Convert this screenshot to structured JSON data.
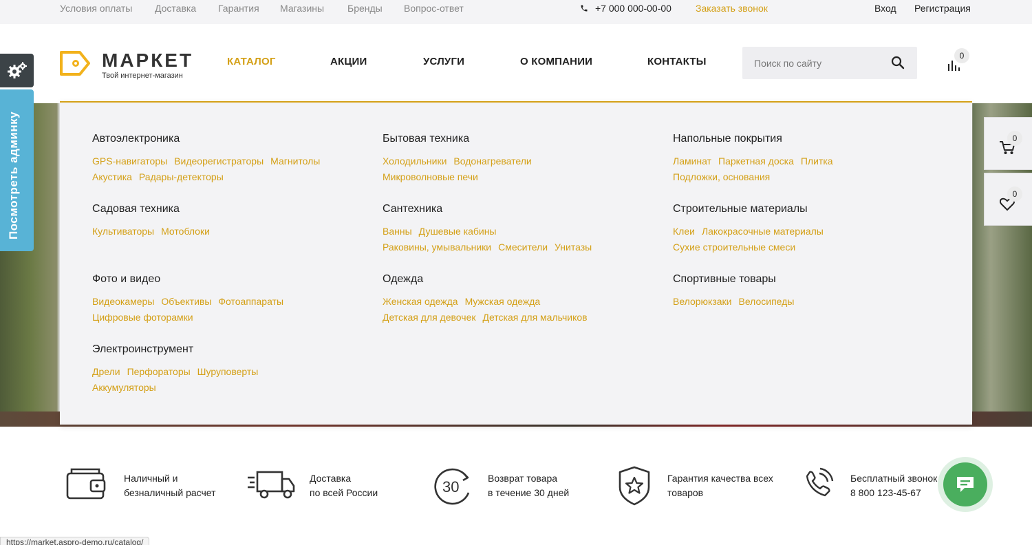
{
  "topbar": {
    "links": [
      "Условия оплаты",
      "Доставка",
      "Гарантия",
      "Магазины",
      "Бренды",
      "Вопрос-ответ"
    ],
    "phone": "+7 000 000-00-00",
    "callback": "Заказать звонок",
    "login": "Вход",
    "register": "Регистрация"
  },
  "logo": {
    "name": "МАРКЕТ",
    "tagline": "Твой интернет-магазин"
  },
  "nav": [
    "КАТАЛОГ",
    "АКЦИИ",
    "УСЛУГИ",
    "О КОМПАНИИ",
    "КОНТАКТЫ"
  ],
  "search": {
    "placeholder": "Поиск по сайту"
  },
  "compare_count": "0",
  "cart_count": "0",
  "favorites_count": "0",
  "admin_tab": "Посмотреть админку",
  "catalog": [
    {
      "title": "Автоэлектроника",
      "links": [
        "GPS-навигаторы",
        "Видеорегистраторы",
        "Магнитолы",
        "Акустика",
        "Радары-детекторы"
      ]
    },
    {
      "title": "Бытовая техника",
      "links": [
        "Холодильники",
        "Водонагреватели",
        "Микроволновые печи"
      ]
    },
    {
      "title": "Напольные покрытия",
      "links": [
        "Ламинат",
        "Паркетная доска",
        "Плитка",
        "Подложки, основания"
      ]
    },
    {
      "title": "Садовая техника",
      "links": [
        "Культиваторы",
        "Мотоблоки"
      ]
    },
    {
      "title": "Сантехника",
      "links": [
        "Ванны",
        "Душевые кабины",
        "Раковины, умывальники",
        "Смесители",
        "Унитазы"
      ]
    },
    {
      "title": "Строительные материалы",
      "links": [
        "Клеи",
        "Лакокрасочные материалы",
        "Сухие строительные смеси"
      ]
    },
    {
      "title": "Фото и видео",
      "links": [
        "Видеокамеры",
        "Объективы",
        "Фотоаппараты",
        "Цифровые фоторамки"
      ]
    },
    {
      "title": "Одежда",
      "links": [
        "Женская одежда",
        "Мужская одежда",
        "Детская для девочек",
        "Детская для мальчиков"
      ]
    },
    {
      "title": "Спортивные товары",
      "links": [
        "Велорюкзаки",
        "Велосипеды"
      ]
    },
    {
      "title": "Электроинструмент",
      "links": [
        "Дрели",
        "Перфораторы",
        "Шуруповерты",
        "Аккумуляторы"
      ]
    }
  ],
  "features": [
    {
      "line1": "Наличный и",
      "line2": "безналичный расчет"
    },
    {
      "line1": "Доставка",
      "line2": "по всей России"
    },
    {
      "line1": "Возврат товара",
      "line2": "в течение 30 дней",
      "icon_text": "30"
    },
    {
      "line1": "Гарантия качества всех",
      "line2": "товаров"
    },
    {
      "line1": "Бесплатный звонок",
      "line2": "8 800 123-45-67"
    }
  ],
  "status_url": "https://market.aspro-demo.ru/catalog/",
  "colors": {
    "accent": "#d4a017",
    "admin_tab": "#58b3d6",
    "chat": "#4aae5e",
    "settings": "#3c4347"
  }
}
